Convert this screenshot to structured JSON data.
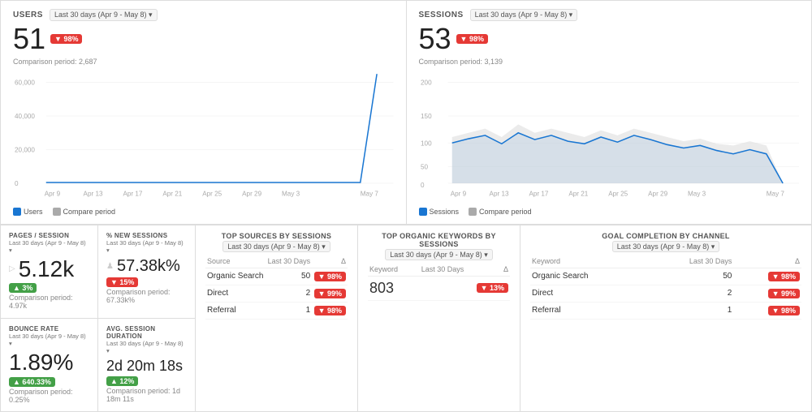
{
  "users_panel": {
    "title": "USERS",
    "period": "Last 30 days (Apr 9 - May 8) ▾",
    "value": "51",
    "badge": "▼ 98%",
    "comparison": "Comparison period: 2,687",
    "x_labels": [
      "Apr 9",
      "Apr 13",
      "Apr 17",
      "Apr 21",
      "Apr 25",
      "Apr 29",
      "May 3",
      "May 7"
    ],
    "legend_current": "Users",
    "legend_compare": "Compare period"
  },
  "sessions_panel": {
    "title": "SESSIONS",
    "period": "Last 30 days (Apr 9 - May 8) ▾",
    "value": "53",
    "badge": "▼ 98%",
    "comparison": "Comparison period: 3,139",
    "x_labels": [
      "Apr 9",
      "Apr 13",
      "Apr 17",
      "Apr 21",
      "Apr 25",
      "Apr 29",
      "May 3",
      "May 7"
    ],
    "legend_current": "Sessions",
    "legend_compare": "Compare period"
  },
  "pages_session": {
    "title": "PAGES / SESSION",
    "period": "Last 30 days (Apr 9 - May 8) ▾",
    "value": "5.12k",
    "badge": "▲ 3%",
    "badge_type": "green",
    "comparison": "Comparison period: 4.97k"
  },
  "new_sessions": {
    "title": "% NEW SESSIONS",
    "period": "Last 30 days (Apr 9 - May 8) ▾",
    "value": "57.38k%",
    "badge": "▼ 15%",
    "badge_type": "red",
    "comparison": "Comparison period: 67.33k%"
  },
  "bounce_rate": {
    "title": "BOUNCE RATE",
    "period": "Last 30 days (Apr 9 - May 8) ▾",
    "value": "1.89%",
    "badge": "▲ 640.33%",
    "badge_type": "green",
    "comparison": "Comparison period: 0.25%"
  },
  "avg_session": {
    "title": "AVG. SESSION DURATION",
    "period": "Last 30 days (Apr 9 - May 8) ▾",
    "value": "2d 20m 18s",
    "badge": "▲ 12%",
    "badge_type": "green",
    "comparison": "Comparison period: 1d 18m 11s"
  },
  "top_sources": {
    "title": "TOP SOURCES BY SESSIONS",
    "period": "Last 30 days (Apr 9 - May 8) ▾",
    "col_source": "Source",
    "col_days": "Last 30 Days",
    "col_delta": "Δ",
    "rows": [
      {
        "source": "Organic Search",
        "value": "50",
        "badge": "▼ 98%",
        "badge_type": "red"
      },
      {
        "source": "Direct",
        "value": "2",
        "badge": "▼ 99%",
        "badge_type": "red"
      },
      {
        "source": "Referral",
        "value": "1",
        "badge": "▼ 98%",
        "badge_type": "red"
      }
    ]
  },
  "top_keywords": {
    "title": "TOP ORGANIC KEYWORDS BY SESSIONS",
    "period": "Last 30 days (Apr 9 - May 8) ▾",
    "col_keyword": "Keyword",
    "col_days": "Last 30 Days",
    "col_delta": "Δ",
    "rows": [
      {
        "keyword": "803",
        "value": "",
        "badge": "▼ 13%",
        "badge_type": "red"
      }
    ]
  },
  "goal_completion": {
    "title": "GOAL COMPLETION BY CHANNEL",
    "period": "Last 30 days (Apr 9 - May 8) ▾",
    "col_keyword": "Keyword",
    "col_days": "Last 30 Days",
    "col_delta": "Δ",
    "rows": [
      {
        "keyword": "Organic Search",
        "value": "50",
        "badge": "▼ 98%",
        "badge_type": "red"
      },
      {
        "keyword": "Direct",
        "value": "2",
        "badge": "▼ 99%",
        "badge_type": "red"
      },
      {
        "keyword": "Referral",
        "value": "1",
        "badge": "▼ 98%",
        "badge_type": "red"
      }
    ]
  }
}
